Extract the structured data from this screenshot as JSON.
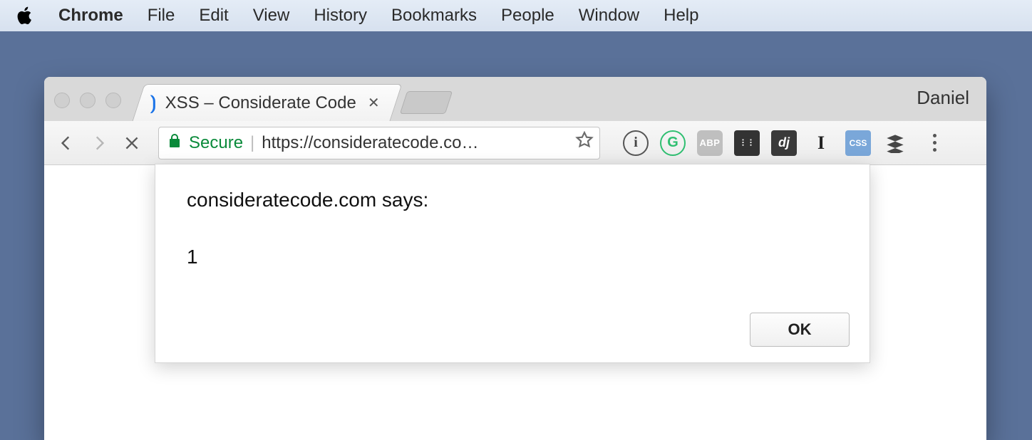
{
  "menubar": {
    "app": "Chrome",
    "items": [
      "File",
      "Edit",
      "View",
      "History",
      "Bookmarks",
      "People",
      "Window",
      "Help"
    ]
  },
  "chrome": {
    "profile_name": "Daniel",
    "tab": {
      "title": "XSS – Considerate Code"
    },
    "omnibox": {
      "secure_label": "Secure",
      "url_display": "https://consideratecode.co…"
    },
    "extensions": {
      "info": "i",
      "grammarly": "G",
      "abp": "ABP",
      "film": "film",
      "django": "dj",
      "instapaper": "I",
      "css": "CSS",
      "buffer": "buffer"
    }
  },
  "alert": {
    "origin_text": "consideratecode.com says:",
    "message": "1",
    "ok_label": "OK"
  }
}
